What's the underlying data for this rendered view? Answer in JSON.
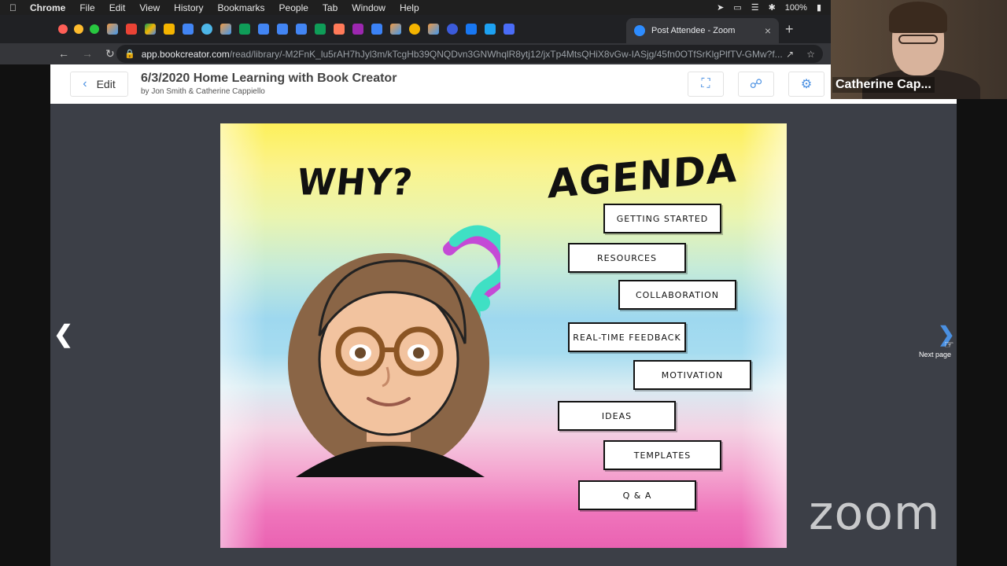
{
  "menubar": {
    "app": "Chrome",
    "items": [
      "File",
      "Edit",
      "View",
      "History",
      "Bookmarks",
      "People",
      "Tab",
      "Window",
      "Help"
    ],
    "battery": "100%"
  },
  "browser": {
    "active_tab_title": "Post Attendee - Zoom",
    "url_domain": "app.bookcreator.com",
    "url_path": "/read/library/-M2FnK_lu5rAH7hJyl3m/kTcgHb39QNQDvn3GNWhqlR8ytj12/jxTp4MtsQHiX8vGw-IASjg/45fn0OTfSrKlgPlfTV-GMw?f..."
  },
  "book": {
    "edit_label": "Edit",
    "title": "6/3/2020 Home Learning with Book Creator",
    "authors": "by Jon Smith & Catherine Cappiello",
    "next_tooltip": "Next page"
  },
  "page": {
    "why": "WHY?",
    "agenda": "AGENDA",
    "agenda_items": [
      "GETTING STARTED",
      "RESOURCES",
      "COLLABORATION",
      "REAL-TIME FEEDBACK",
      "MOTIVATION",
      "IDEAS",
      "TEMPLATES",
      "Q & A"
    ]
  },
  "zoom": {
    "participant_name": "Catherine Cap...",
    "logo": "zoom"
  },
  "colors": {
    "accent": "#4a90e2",
    "book_bg": "#3c3f47"
  }
}
